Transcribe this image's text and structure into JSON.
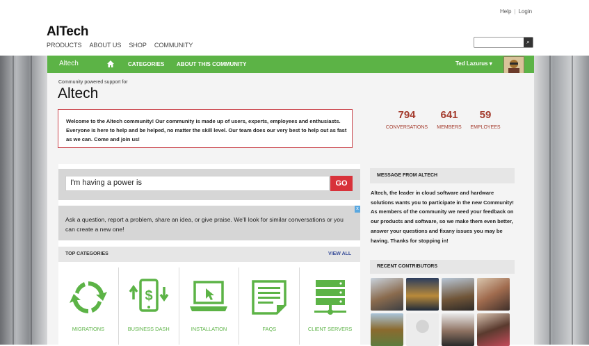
{
  "top_links": {
    "help": "Help",
    "separator": "|",
    "login": "Login"
  },
  "logo": "AlTech",
  "site_nav": [
    "PRODUCTS",
    "ABOUT US",
    "SHOP",
    "COMMUNITY"
  ],
  "green_nav": {
    "brand": "Altech",
    "categories": "CATEGORIES",
    "about": "ABOUT THIS COMMUNITY",
    "user": "Ted Lazurus ▾"
  },
  "community": {
    "powered_by": "Community powered support for",
    "title": "Altech",
    "welcome": "Welcome to the Altech community! Our community is made up of users, experts, employees and enthusiasts. Everyone is here to help and be helped, no matter the skill level. Our team does our very best to help out as fast as we can. Come and join us!"
  },
  "stats": [
    {
      "value": "794",
      "label": "CONVERSATIONS"
    },
    {
      "value": "641",
      "label": "MEMBERS"
    },
    {
      "value": "59",
      "label": "EMPLOYEES"
    }
  ],
  "ask": {
    "value": "I'm having a power is",
    "go": "GO",
    "hint": "Ask a question, report a problem, share an idea, or give praise. We'll look for similar conversations or you can create a new one!",
    "close": "x"
  },
  "top_categories": {
    "label": "TOP CATEGORIES",
    "view_all": "VIEW ALL",
    "items": [
      "MIGRATIONS",
      "BUSINESS DASH",
      "INSTALLATION",
      "FAQS",
      "CLIENT SERVERS"
    ]
  },
  "message": {
    "title": "MESSAGE FROM ALTECH",
    "body": "Altech, the leader in cloud software and hardware solutions wants you to participate in the new Community! As members of the community we need your feedback on our products and software, so we make them even better, answer your questions and fixany issues you may be having. Thanks for stopping in!"
  },
  "contributors": {
    "title": "RECENT CONTRIBUTORS"
  },
  "colors": {
    "brand_green": "#5cb346",
    "accent_red": "#d8323a",
    "stat_red": "#a43b2d",
    "link_blue": "#3a4f9a"
  }
}
